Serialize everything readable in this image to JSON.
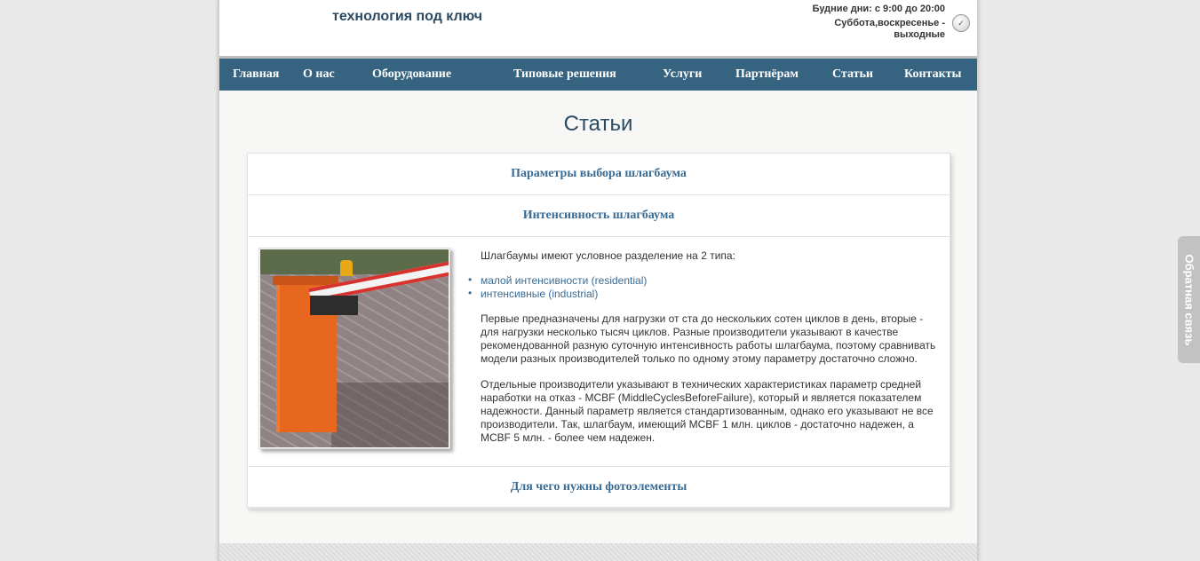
{
  "header": {
    "tagline": "технология под ключ",
    "hours_line1": "Будние дни: с 9:00 до 20:00",
    "hours_line2": "Суббота,воскресенье -",
    "hours_line3": "выходные",
    "clock_icon": "clock-icon"
  },
  "nav": {
    "items": [
      {
        "label": "Главная"
      },
      {
        "label": "О нас"
      },
      {
        "label": "Оборудование"
      },
      {
        "label": "Типовые решения"
      },
      {
        "label": "Услуги"
      },
      {
        "label": "Партнёрам"
      },
      {
        "label": "Статьи"
      },
      {
        "label": "Контакты"
      }
    ]
  },
  "main": {
    "title": "Статьи",
    "articles": [
      {
        "title": "Параметры выбора шлагбаума"
      },
      {
        "title": "Интенсивность шлагбаума"
      },
      {
        "title": "Для чего нужны фотоэлементы"
      }
    ],
    "expanded": {
      "intro": "Шлагбаумы имеют условное разделение на 2 типа:",
      "types": [
        "малой интенсивности (residential)",
        "интенсивные (industrial)"
      ],
      "para1": "Первые предназначены для нагрузки от ста до нескольких сотен циклов в день, вторые - для нагрузки несколько тысяч циклов. Разные производители указывают в качестве рекомендованной разную суточную интенсивность работы шлагбаума, поэтому сравнивать модели разных производителей только по одному этому параметру достаточно сложно.",
      "para2": "Отдельные производители указывают в технических характеристиках параметр средней наработки на отказ - MCBF (MiddleCyclesBeforeFailure), который и является показателем надежности. Данный параметр является стандартизованным, однако его указывают не все производители. Так, шлагбаум, имеющий MCBF 1 млн. циклов - достаточно надежен, а MCBF 5 млн. - более чем надежен."
    }
  },
  "feedback": {
    "label": "Обратная связь"
  },
  "colors": {
    "nav_bg": "#36637f",
    "accent": "#3a6b93",
    "title": "#2b4a63"
  }
}
